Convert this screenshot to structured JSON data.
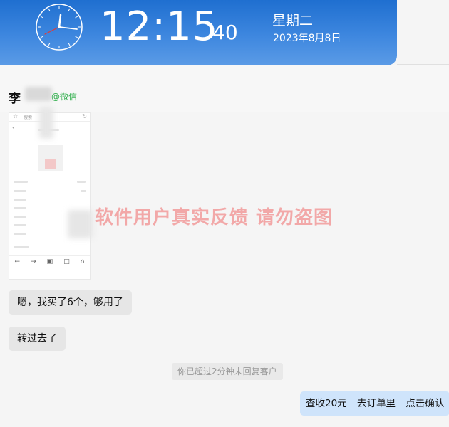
{
  "clock": {
    "time": "12:15",
    "seconds": "40",
    "weekday": "星期二",
    "date": "2023年8月8日"
  },
  "contact": {
    "name": "李",
    "tag": "@微信"
  },
  "screenshot_thumb": {
    "search_text": "搜索",
    "nav_icons": [
      "←",
      "→",
      "▣",
      "□",
      "⌂"
    ]
  },
  "watermark": "软件用户真实反馈  请勿盗图",
  "messages": [
    {
      "text": "嗯，我买了6个，够用了"
    },
    {
      "text": "转过去了"
    }
  ],
  "system_notice": "你已超过2分钟未回复客户",
  "outgoing": {
    "parts": [
      "查收20元",
      "去订单里",
      "点击确认"
    ]
  },
  "colors": {
    "header_blue": "#1f6fd0",
    "watermark": "#f2a8a8",
    "outgoing_bubble": "#cfe4fb",
    "wechat_green": "#38b153"
  }
}
